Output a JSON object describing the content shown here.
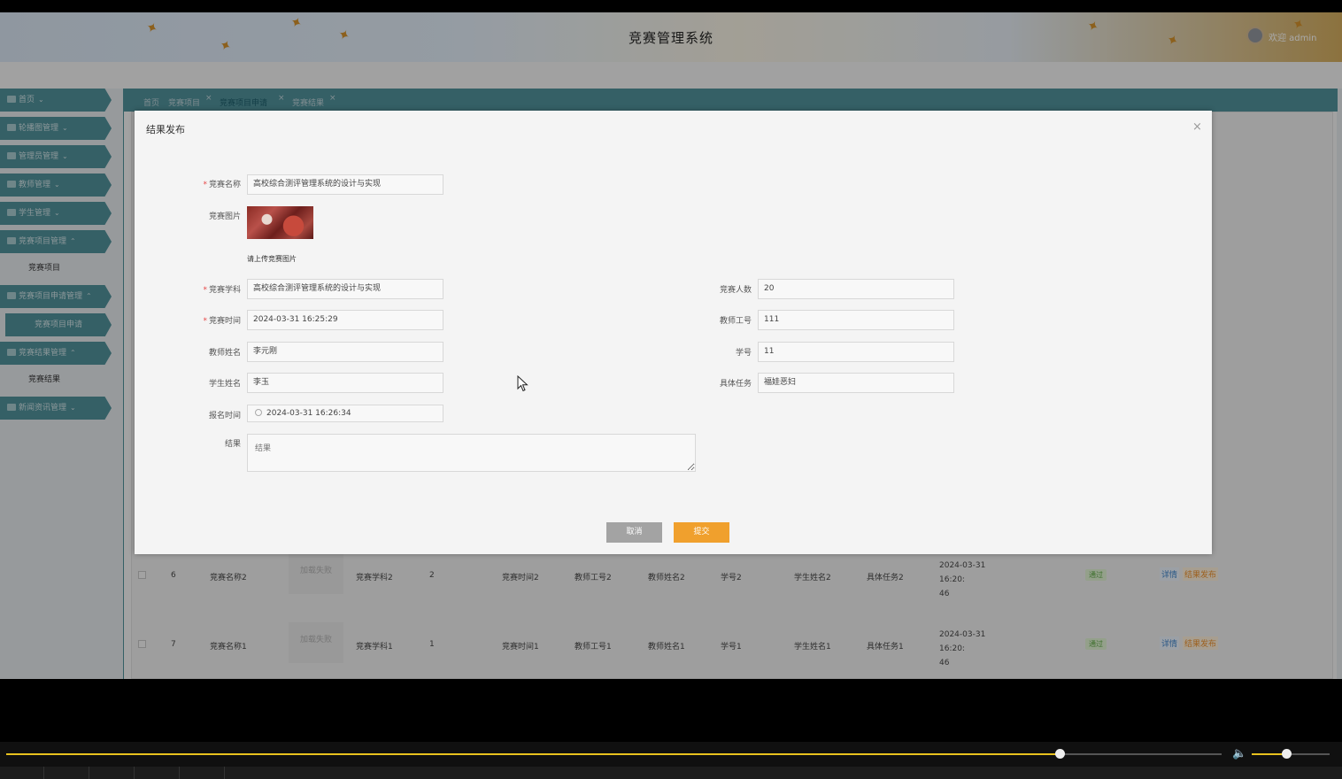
{
  "header": {
    "title": "竞赛管理系统",
    "welcome": "欢迎 admin"
  },
  "sidebar": {
    "items": [
      {
        "label": "首页",
        "chev": "⌄"
      },
      {
        "label": "轮播图管理",
        "chev": "⌄"
      },
      {
        "label": "管理员管理",
        "chev": "⌄"
      },
      {
        "label": "教师管理",
        "chev": "⌄"
      },
      {
        "label": "学生管理",
        "chev": "⌄"
      },
      {
        "label": "竞赛项目管理",
        "chev": "⌃"
      },
      {
        "label": "竞赛项目申请管理",
        "chev": "⌃"
      },
      {
        "label": "竞赛结果管理",
        "chev": "⌃"
      },
      {
        "label": "新闻资讯管理",
        "chev": "⌄"
      }
    ],
    "subs": [
      {
        "label": "竞赛项目"
      },
      {
        "label": "竞赛项目申请"
      },
      {
        "label": "竞赛结果"
      }
    ]
  },
  "tabs": [
    {
      "label": "首页"
    },
    {
      "label": "竞赛项目"
    },
    {
      "label": "竞赛项目申请"
    },
    {
      "label": "竞赛结果"
    }
  ],
  "table_rows": [
    {
      "no": "6",
      "name": "竞赛名称2",
      "img": "加载失败",
      "subject": "竞赛学科2",
      "count": "2",
      "time": "竞赛时间2",
      "teacher_id": "教师工号2",
      "teacher_name": "教师姓名2",
      "student_id": "学号2",
      "student_name": "学生姓名2",
      "task": "具体任务2",
      "ts_line1": "2024-03-31 16:20:",
      "ts_line2": "46",
      "status": "通过",
      "detail": "详情",
      "publish": "结果发布"
    },
    {
      "no": "7",
      "name": "竞赛名称1",
      "img": "加载失败",
      "subject": "竞赛学科1",
      "count": "1",
      "time": "竞赛时间1",
      "teacher_id": "教师工号1",
      "teacher_name": "教师姓名1",
      "student_id": "学号1",
      "student_name": "学生姓名1",
      "task": "具体任务1",
      "ts_line1": "2024-03-31 16:20:",
      "ts_line2": "46",
      "status": "通过",
      "detail": "详情",
      "publish": "结果发布"
    }
  ],
  "modal": {
    "title": "结果发布",
    "close": "×",
    "labels": {
      "name": "竞赛名称",
      "image": "竞赛图片",
      "subject": "竞赛学科",
      "time": "竞赛时间",
      "teacher_name": "教师姓名",
      "student_name": "学生姓名",
      "apply_time": "报名时间",
      "result": "结果",
      "count": "竞赛人数",
      "teacher_id": "教师工号",
      "student_id": "学号",
      "task": "具体任务"
    },
    "values": {
      "name": "高校综合测评管理系统的设计与实现",
      "subject": "高校综合测评管理系统的设计与实现",
      "time": "2024-03-31 16:25:29",
      "teacher_name": "李元刚",
      "student_name": "李玉",
      "apply_time": "2024-03-31 16:26:34",
      "count": "20",
      "teacher_id": "111",
      "student_id": "11",
      "task": "福娃恶妇"
    },
    "upload_hint": "请上传竞赛图片",
    "result_placeholder": "结果",
    "cancel_label": "取消",
    "submit_label": "提交"
  },
  "player": {
    "progress": 0.867,
    "volume": 0.44
  },
  "colors": {
    "teal": "#4c8a93",
    "submit": "#f0a02d",
    "cancel": "#a3a3a3",
    "seek": "#e8c11e"
  }
}
